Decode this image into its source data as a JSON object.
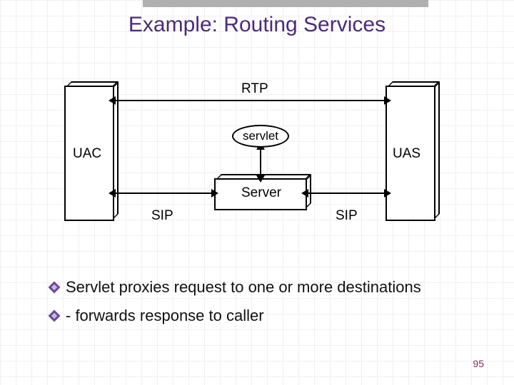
{
  "title": "Example: Routing Services",
  "diagram": {
    "uac_label": "UAC",
    "uas_label": "UAS",
    "server_label": "Server",
    "servlet_label": "servlet",
    "rtp_label": "RTP",
    "sip_label_left": "SIP",
    "sip_label_right": "SIP"
  },
  "bullets": {
    "b1": "Servlet proxies request to one or more destinations",
    "b2": "- forwards response to caller"
  },
  "page_number": "95"
}
